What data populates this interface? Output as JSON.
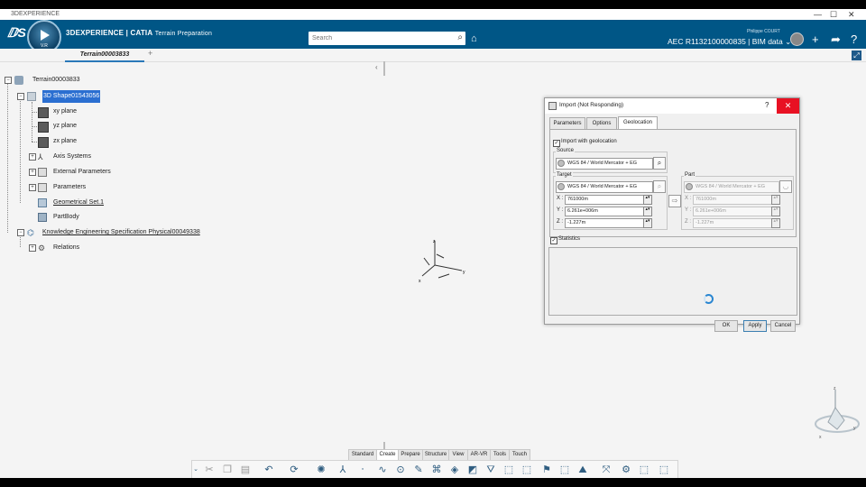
{
  "window": {
    "title": "3DEXPERIENCE",
    "minimize": "—",
    "maximize": "☐",
    "close": "✕"
  },
  "topbar": {
    "brand_bold": "3DEXPERIENCE | CATIA",
    "brand_app": "Terrain Preparation",
    "compass_version": "V.R",
    "search_placeholder": "Search",
    "user_name": "Philippe COURT",
    "project": "AEC R1132100000835 | BIM data ⌄",
    "brand_color": "#005686"
  },
  "tabs": {
    "active": "Terrain00003833",
    "add": "+"
  },
  "tree": {
    "root": "Terrain00003833",
    "shape": "3D Shape01543056",
    "planes": [
      "xy plane",
      "yz plane",
      "zx plane"
    ],
    "children": [
      "Axis Systems",
      "External Parameters",
      "Parameters",
      "Geometrical Set.1",
      "PartBody"
    ],
    "kes": "Knowledge Engineering Specification Physical00049338",
    "relations": "Relations"
  },
  "axis": {
    "x": "x",
    "y": "y",
    "z": "z"
  },
  "dialog": {
    "title": "Import (Not Responding)",
    "help": "?",
    "tabs": [
      "Parameters",
      "Options",
      "Geolocation"
    ],
    "active_tab": "Geolocation",
    "import_geo": "Import with geolocation",
    "source_label": "Source",
    "source_value": "WGS 84 / World Mercator +  EG",
    "target_label": "Target",
    "target_value": "WGS 84 / World Mercator +  EG",
    "part_label": "Part",
    "part_value": "WGS 84 / World Mercator +  EG",
    "x_label": "X :",
    "y_label": "Y :",
    "z_label": "Z :",
    "target_x": "761000m",
    "target_y": "6.261e+006m",
    "target_z": "-1.227m",
    "part_x": "761000m",
    "part_y": "6.261e+006m",
    "part_z": "-1.227m",
    "statistics": "Statistics",
    "ok": "OK",
    "apply": "Apply",
    "cancel": "Cancel"
  },
  "command_tabs": [
    "Standard",
    "Create",
    "Prepare",
    "Structure",
    "View",
    "AR-VR",
    "Tools",
    "Touch"
  ],
  "active_command_tab": "Create"
}
